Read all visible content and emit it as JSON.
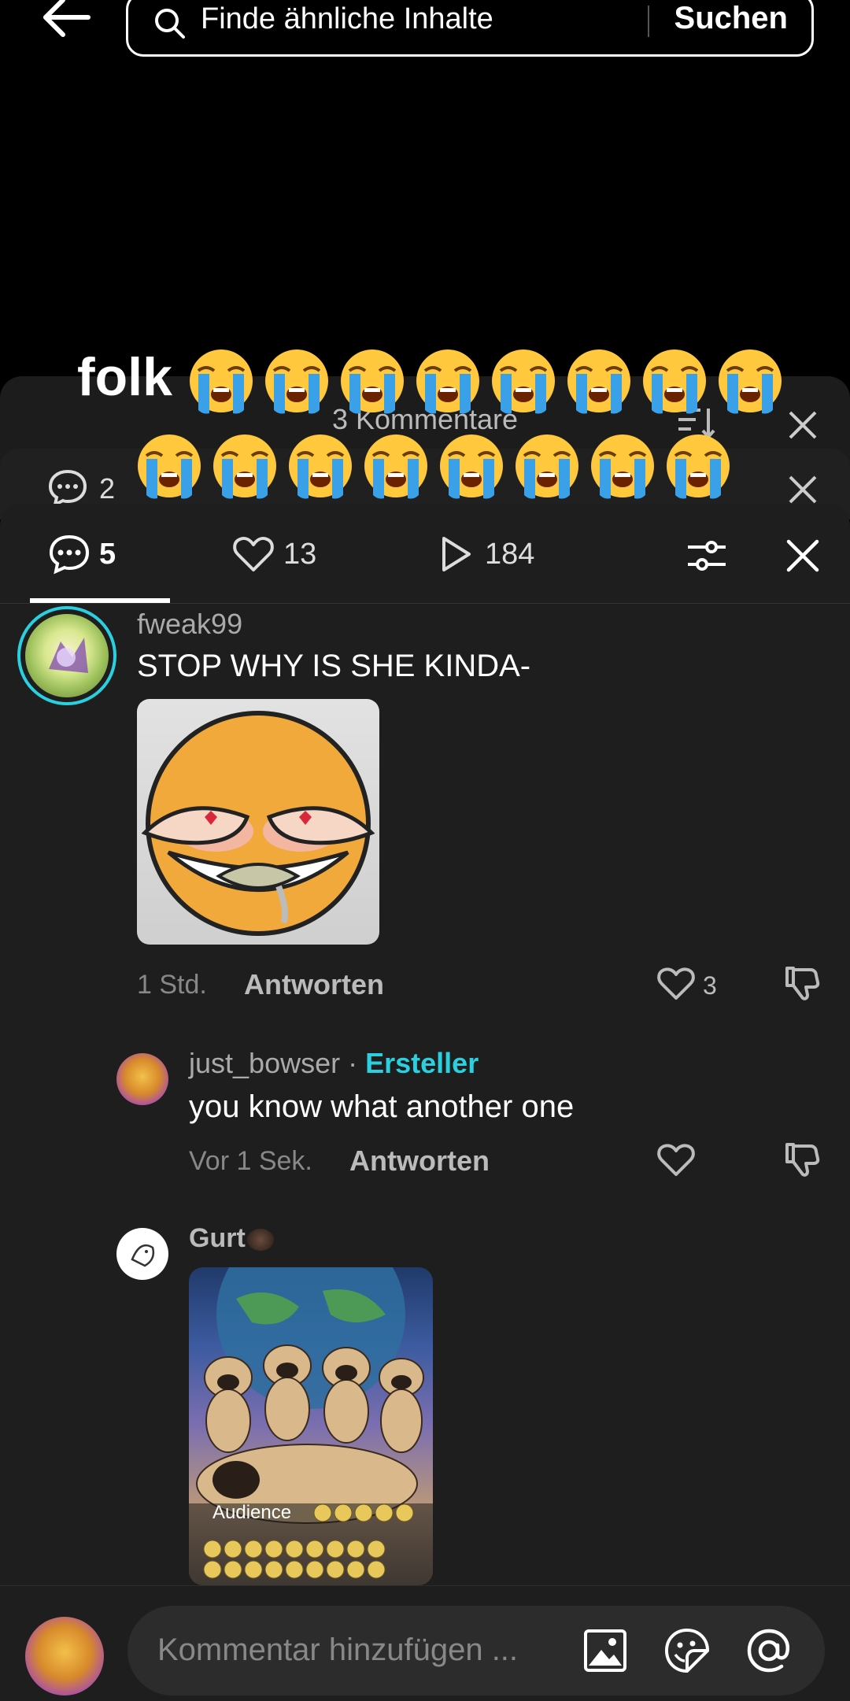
{
  "search": {
    "placeholder": "Finde ähnliche Inhalte",
    "button": "Suchen"
  },
  "overlay": {
    "caption_word": "folk",
    "emoji_row1_count": 8,
    "emoji_row2_count": 8,
    "emoji": "loudly-crying-face"
  },
  "ghost_sheets": {
    "title": "3 Kommentare",
    "count": "2"
  },
  "tabs": {
    "comments": "5",
    "likes": "13",
    "views": "184"
  },
  "comments": [
    {
      "username": "fweak99",
      "text": "STOP WHY IS SHE KINDA-",
      "time": "1 Std.",
      "reply_label": "Antworten",
      "likes": "3",
      "has_image": true
    },
    {
      "username": "just_bowser",
      "separator": "·",
      "creator_badge": "Ersteller",
      "text": "you know what another one",
      "time": "Vor 1 Sek.",
      "reply_label": "Antworten"
    },
    {
      "username": "Gurt",
      "image_text": "Audience",
      "has_image": true
    }
  ],
  "composer": {
    "placeholder": "Kommentar hinzufügen ..."
  },
  "colors": {
    "accent": "#2ad0e0",
    "sheet_bg": "#1e1e1e",
    "creator": "#2ad0e0"
  }
}
